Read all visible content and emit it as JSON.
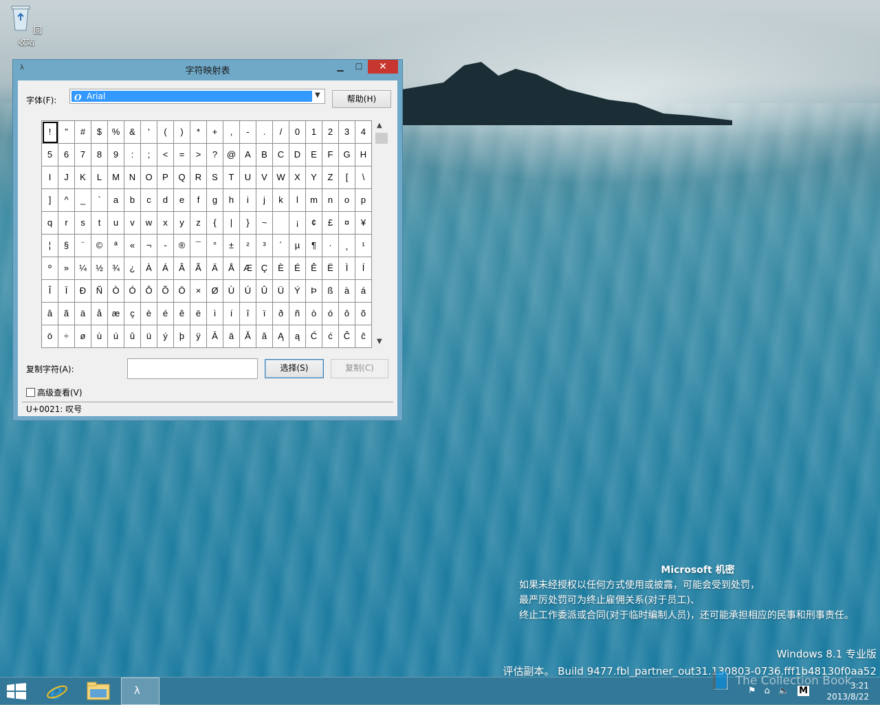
{
  "desktop": {
    "recycle_bin_label": "回收站",
    "notice": {
      "heading": "Microsoft 机密",
      "lines": [
        "如果未经授权以任何方式使用或披露，可能会受到处罚，",
        "最严厉处罚可为终止雇佣关系(对于员工)、",
        "终止工作委派或合同(对于临时编制人员)，还可能承担相应的民事和刑事责任。"
      ]
    },
    "build_line1": "Windows 8.1 专业版",
    "build_line2": "评估副本。 Build 9477.fbl_partner_out31.130803-0736.fff1b48130f0aa52",
    "watermark": "The Collection Book"
  },
  "window": {
    "title": "字符映射表",
    "font_label": "字体(F):",
    "font_value": "Arial",
    "font_icon_glyph": "O",
    "help_button": "帮助(H)",
    "characters": [
      [
        "!",
        "\"",
        "#",
        "$",
        "%",
        "&",
        "'",
        "(",
        ")",
        "*",
        "+",
        ",",
        "-",
        ".",
        "/",
        "0",
        "1",
        "2",
        "3",
        "4"
      ],
      [
        "5",
        "6",
        "7",
        "8",
        "9",
        ":",
        ";",
        "<",
        "=",
        ">",
        "?",
        "@",
        "A",
        "B",
        "C",
        "D",
        "E",
        "F",
        "G",
        "H"
      ],
      [
        "I",
        "J",
        "K",
        "L",
        "M",
        "N",
        "O",
        "P",
        "Q",
        "R",
        "S",
        "T",
        "U",
        "V",
        "W",
        "X",
        "Y",
        "Z",
        "[",
        "\\"
      ],
      [
        "]",
        "^",
        "_",
        "`",
        "a",
        "b",
        "c",
        "d",
        "e",
        "f",
        "g",
        "h",
        "i",
        "j",
        "k",
        "l",
        "m",
        "n",
        "o",
        "p"
      ],
      [
        "q",
        "r",
        "s",
        "t",
        "u",
        "v",
        "w",
        "x",
        "y",
        "z",
        "{",
        "|",
        "}",
        "~",
        " ",
        "¡",
        "¢",
        "£",
        "¤",
        "¥"
      ],
      [
        "¦",
        "§",
        "¨",
        "©",
        "ª",
        "«",
        "¬",
        "-",
        "®",
        "¯",
        "°",
        "±",
        "²",
        "³",
        "´",
        "µ",
        "¶",
        "·",
        "¸",
        "¹"
      ],
      [
        "º",
        "»",
        "¼",
        "½",
        "¾",
        "¿",
        "À",
        "Á",
        "Â",
        "Ã",
        "Ä",
        "Å",
        "Æ",
        "Ç",
        "È",
        "É",
        "Ê",
        "Ë",
        "Ì",
        "Í"
      ],
      [
        "Î",
        "Ï",
        "Ð",
        "Ñ",
        "Ò",
        "Ó",
        "Ô",
        "Õ",
        "Ö",
        "×",
        "Ø",
        "Ù",
        "Ú",
        "Û",
        "Ü",
        "Ý",
        "Þ",
        "ß",
        "à",
        "á"
      ],
      [
        "â",
        "ã",
        "ä",
        "å",
        "æ",
        "ç",
        "è",
        "é",
        "ê",
        "ë",
        "ì",
        "í",
        "î",
        "ï",
        "ð",
        "ñ",
        "ò",
        "ó",
        "ô",
        "õ"
      ],
      [
        "ö",
        "÷",
        "ø",
        "ù",
        "ú",
        "û",
        "ü",
        "ý",
        "þ",
        "ÿ",
        "Ā",
        "ā",
        "Ă",
        "ă",
        "Ą",
        "ą",
        "Ć",
        "ć",
        "Ĉ",
        "ĉ"
      ]
    ],
    "selected_char_index": 0,
    "copy_label": "复制字符(A):",
    "copy_value": "",
    "select_button": "选择(S)",
    "copy_button": "复制(C)",
    "advanced_label": "高级查看(V)",
    "advanced_checked": false,
    "status": "U+0021: 叹号"
  },
  "taskbar": {
    "items": [
      "start",
      "internet-explorer",
      "file-explorer",
      "character-map"
    ],
    "active_item": "character-map",
    "time": "3:21",
    "date": "2013/8/22"
  },
  "colors": {
    "selection": "#3399ff",
    "close_button": "#c7372f",
    "window_frame": "#70a9c8"
  }
}
